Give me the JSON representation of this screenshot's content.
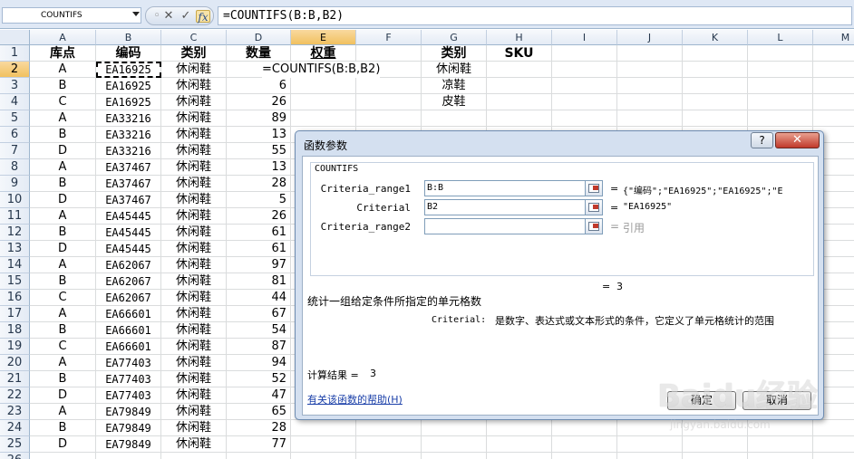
{
  "formula_bar": {
    "name_box": "COUNTIFS",
    "cancel_icon": "✕",
    "enter_icon": "✓",
    "fx_label": "fx",
    "formula": "=COUNTIFS(B:B,B2)"
  },
  "columns": [
    "A",
    "B",
    "C",
    "D",
    "E",
    "F",
    "G",
    "H",
    "I",
    "J",
    "K",
    "L",
    "M"
  ],
  "rows": [
    "1",
    "2",
    "3",
    "4",
    "5",
    "6",
    "7",
    "8",
    "9",
    "10",
    "11",
    "12",
    "13",
    "14",
    "15",
    "16",
    "17",
    "18",
    "19",
    "20",
    "21",
    "22",
    "23",
    "24",
    "25",
    "26"
  ],
  "headers": {
    "a": "库点",
    "b": "编码",
    "c": "类别",
    "d": "数量",
    "e": "权重",
    "g": "类别",
    "h": "SKU"
  },
  "table": [
    [
      "A",
      "EA16925",
      "休闲鞋",
      ""
    ],
    [
      "B",
      "EA16925",
      "休闲鞋",
      "6"
    ],
    [
      "C",
      "EA16925",
      "休闲鞋",
      "26"
    ],
    [
      "A",
      "EA33216",
      "休闲鞋",
      "89"
    ],
    [
      "B",
      "EA33216",
      "休闲鞋",
      "13"
    ],
    [
      "D",
      "EA33216",
      "休闲鞋",
      "55"
    ],
    [
      "A",
      "EA37467",
      "休闲鞋",
      "13"
    ],
    [
      "B",
      "EA37467",
      "休闲鞋",
      "28"
    ],
    [
      "D",
      "EA37467",
      "休闲鞋",
      "5"
    ],
    [
      "A",
      "EA45445",
      "休闲鞋",
      "26"
    ],
    [
      "B",
      "EA45445",
      "休闲鞋",
      "61"
    ],
    [
      "D",
      "EA45445",
      "休闲鞋",
      "61"
    ],
    [
      "A",
      "EA62067",
      "休闲鞋",
      "97"
    ],
    [
      "B",
      "EA62067",
      "休闲鞋",
      "81"
    ],
    [
      "C",
      "EA62067",
      "休闲鞋",
      "44"
    ],
    [
      "A",
      "EA66601",
      "休闲鞋",
      "67"
    ],
    [
      "B",
      "EA66601",
      "休闲鞋",
      "54"
    ],
    [
      "C",
      "EA66601",
      "休闲鞋",
      "87"
    ],
    [
      "A",
      "EA77403",
      "休闲鞋",
      "94"
    ],
    [
      "B",
      "EA77403",
      "休闲鞋",
      "52"
    ],
    [
      "D",
      "EA77403",
      "休闲鞋",
      "47"
    ],
    [
      "A",
      "EA79849",
      "休闲鞋",
      "65"
    ],
    [
      "B",
      "EA79849",
      "休闲鞋",
      "28"
    ],
    [
      "D",
      "EA79849",
      "休闲鞋",
      "77"
    ]
  ],
  "cell_formula": "=COUNTIFS(B:B,B2)",
  "category_list": [
    "休闲鞋",
    "凉鞋",
    "皮鞋"
  ],
  "dialog": {
    "title": "函数参数",
    "help_button": "?",
    "close_button": "✕",
    "function_name": "COUNTIFS",
    "args": [
      {
        "label": "Criteria_range1",
        "value": "B:B",
        "result": "{\"编码\";\"EA16925\";\"EA16925\";\"E"
      },
      {
        "label": "Criterial",
        "value": "B2",
        "result": "\"EA16925\""
      },
      {
        "label": "Criteria_range2",
        "value": "",
        "result": "引用"
      }
    ],
    "equals_sign": "=",
    "overall_result": "3",
    "description": "统计一组给定条件所指定的单元格数",
    "arg_help_name": "Criterial:",
    "arg_help_text": "是数字、表达式或文本形式的条件，它定义了单元格统计的范围",
    "calc_result_label": "计算结果 =",
    "calc_result_value": "3",
    "help_link": "有关该函数的帮助(H)",
    "ok_button": "确定",
    "cancel_button": "取消"
  },
  "watermark": {
    "brand": "Baidu经验",
    "url": "jingyan.baidu.com"
  }
}
